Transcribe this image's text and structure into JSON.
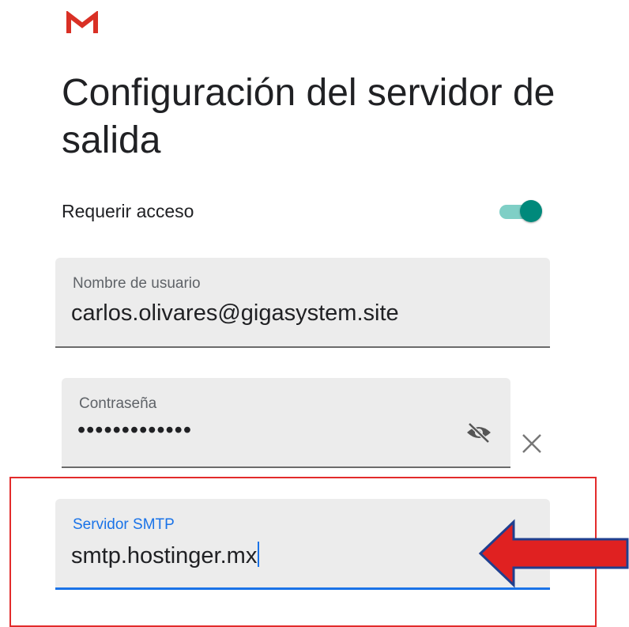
{
  "app": {
    "logo_icon": "gmail-logo-icon",
    "logo_color": "#d93025"
  },
  "page": {
    "title": "Configuración del servidor de salida"
  },
  "settings": {
    "require_login_label": "Requerir acceso",
    "require_login_enabled": true,
    "accent_color": "#00897b"
  },
  "fields": {
    "username": {
      "label": "Nombre de usuario",
      "value": "carlos.olivares@gigasystem.site"
    },
    "password": {
      "label": "Contraseña",
      "value": "•••••••••••••",
      "toggle_icon": "visibility-off-icon",
      "clear_icon": "close-icon"
    },
    "smtp": {
      "label": "Servidor SMTP",
      "value": "smtp.hostinger.mx",
      "focus_color": "#1a73e8"
    }
  },
  "annotation": {
    "highlight_color": "#e32b2b",
    "arrow_icon": "left-arrow-icon"
  }
}
